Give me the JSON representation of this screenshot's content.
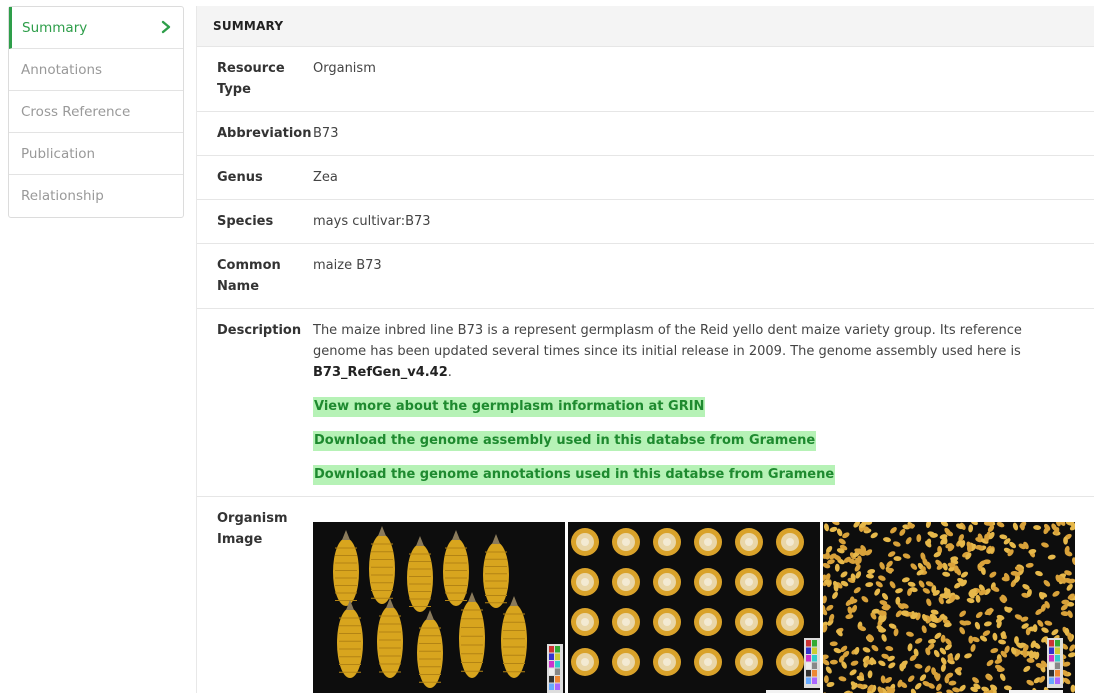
{
  "sidebar": {
    "items": [
      {
        "label": "Summary",
        "active": true
      },
      {
        "label": "Annotations",
        "active": false
      },
      {
        "label": "Cross Reference",
        "active": false
      },
      {
        "label": "Publication",
        "active": false
      },
      {
        "label": "Relationship",
        "active": false
      }
    ],
    "active_icon": "chevron-right-icon",
    "accent_color": "#2e9e4a"
  },
  "panel": {
    "title": "SUMMARY"
  },
  "details": {
    "resource_type": {
      "label": "Resource Type",
      "value": "Organism"
    },
    "abbreviation": {
      "label": "Abbreviation",
      "value": "B73"
    },
    "genus": {
      "label": "Genus",
      "value": "Zea"
    },
    "species": {
      "label": "Species",
      "value": "mays cultivar:B73"
    },
    "common_name": {
      "label": "Common Name",
      "value": "maize B73"
    },
    "description": {
      "label": "Description",
      "text": "The maize inbred line B73 is a represent germplasm of the Reid yello dent maize variety group. Its reference genome has been updated several times since its initial release in 2009. The genome assembly used here is ",
      "assembly": "B73_RefGen_v4.42",
      "end": ".",
      "links": [
        "View more about the germplasm information at GRIN",
        "Download the genome assembly used in this databse from Gramene",
        "Download the genome annotations used in this databse from Gramene"
      ],
      "link_bg_color": "#b6f2b6",
      "link_text_color": "#1e8a2f"
    },
    "organism_image": {
      "label": "Organism Image",
      "images": [
        "maize-ears-photo",
        "maize-cob-cross-sections-photo",
        "maize-kernels-photo"
      ]
    }
  }
}
